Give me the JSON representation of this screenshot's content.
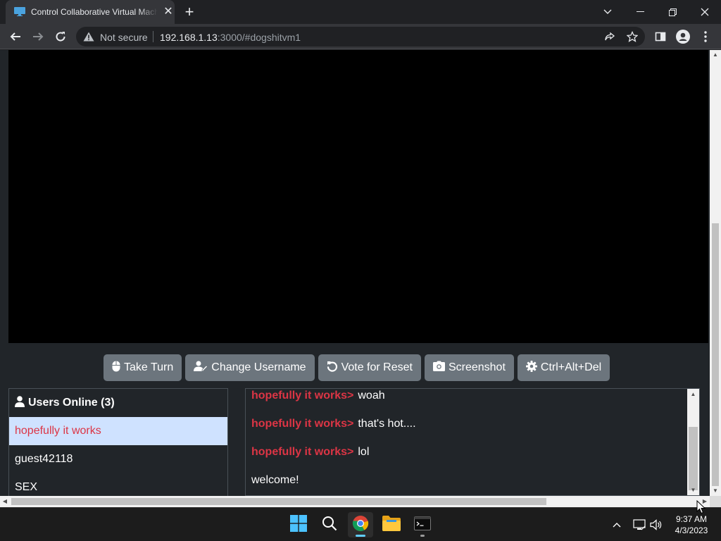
{
  "browser": {
    "tab": {
      "title": "Control Collaborative Virtual Machine!",
      "favicon": "monitor-icon"
    },
    "address": {
      "security_label": "Not secure",
      "host": "192.168.1.13",
      "path": ":3000/#dogshitvm1"
    }
  },
  "vm": {
    "buttons": [
      {
        "label": "Take Turn",
        "icon": "mouse-icon"
      },
      {
        "label": "Change Username",
        "icon": "user-edit-icon"
      },
      {
        "label": "Vote for Reset",
        "icon": "reset-icon"
      },
      {
        "label": "Screenshot",
        "icon": "camera-icon"
      },
      {
        "label": "Ctrl+Alt+Del",
        "icon": "gear-icon"
      }
    ],
    "users": {
      "header": "Users Online (3)",
      "list": [
        "hopefully it works",
        "guest42118",
        "SEX"
      ]
    },
    "chat": [
      {
        "user": "hopefully it works>",
        "text": "woah"
      },
      {
        "user": "hopefully it works>",
        "text": "that's hot...."
      },
      {
        "user": "hopefully it works>",
        "text": "lol"
      },
      {
        "user": "",
        "text": "welcome!"
      }
    ]
  },
  "taskbar": {
    "time": "9:37 AM",
    "date": "4/3/2023"
  },
  "colors": {
    "accent_red": "#dc3545",
    "button_gray": "#6c757d",
    "selected_row": "#cfe2ff"
  }
}
